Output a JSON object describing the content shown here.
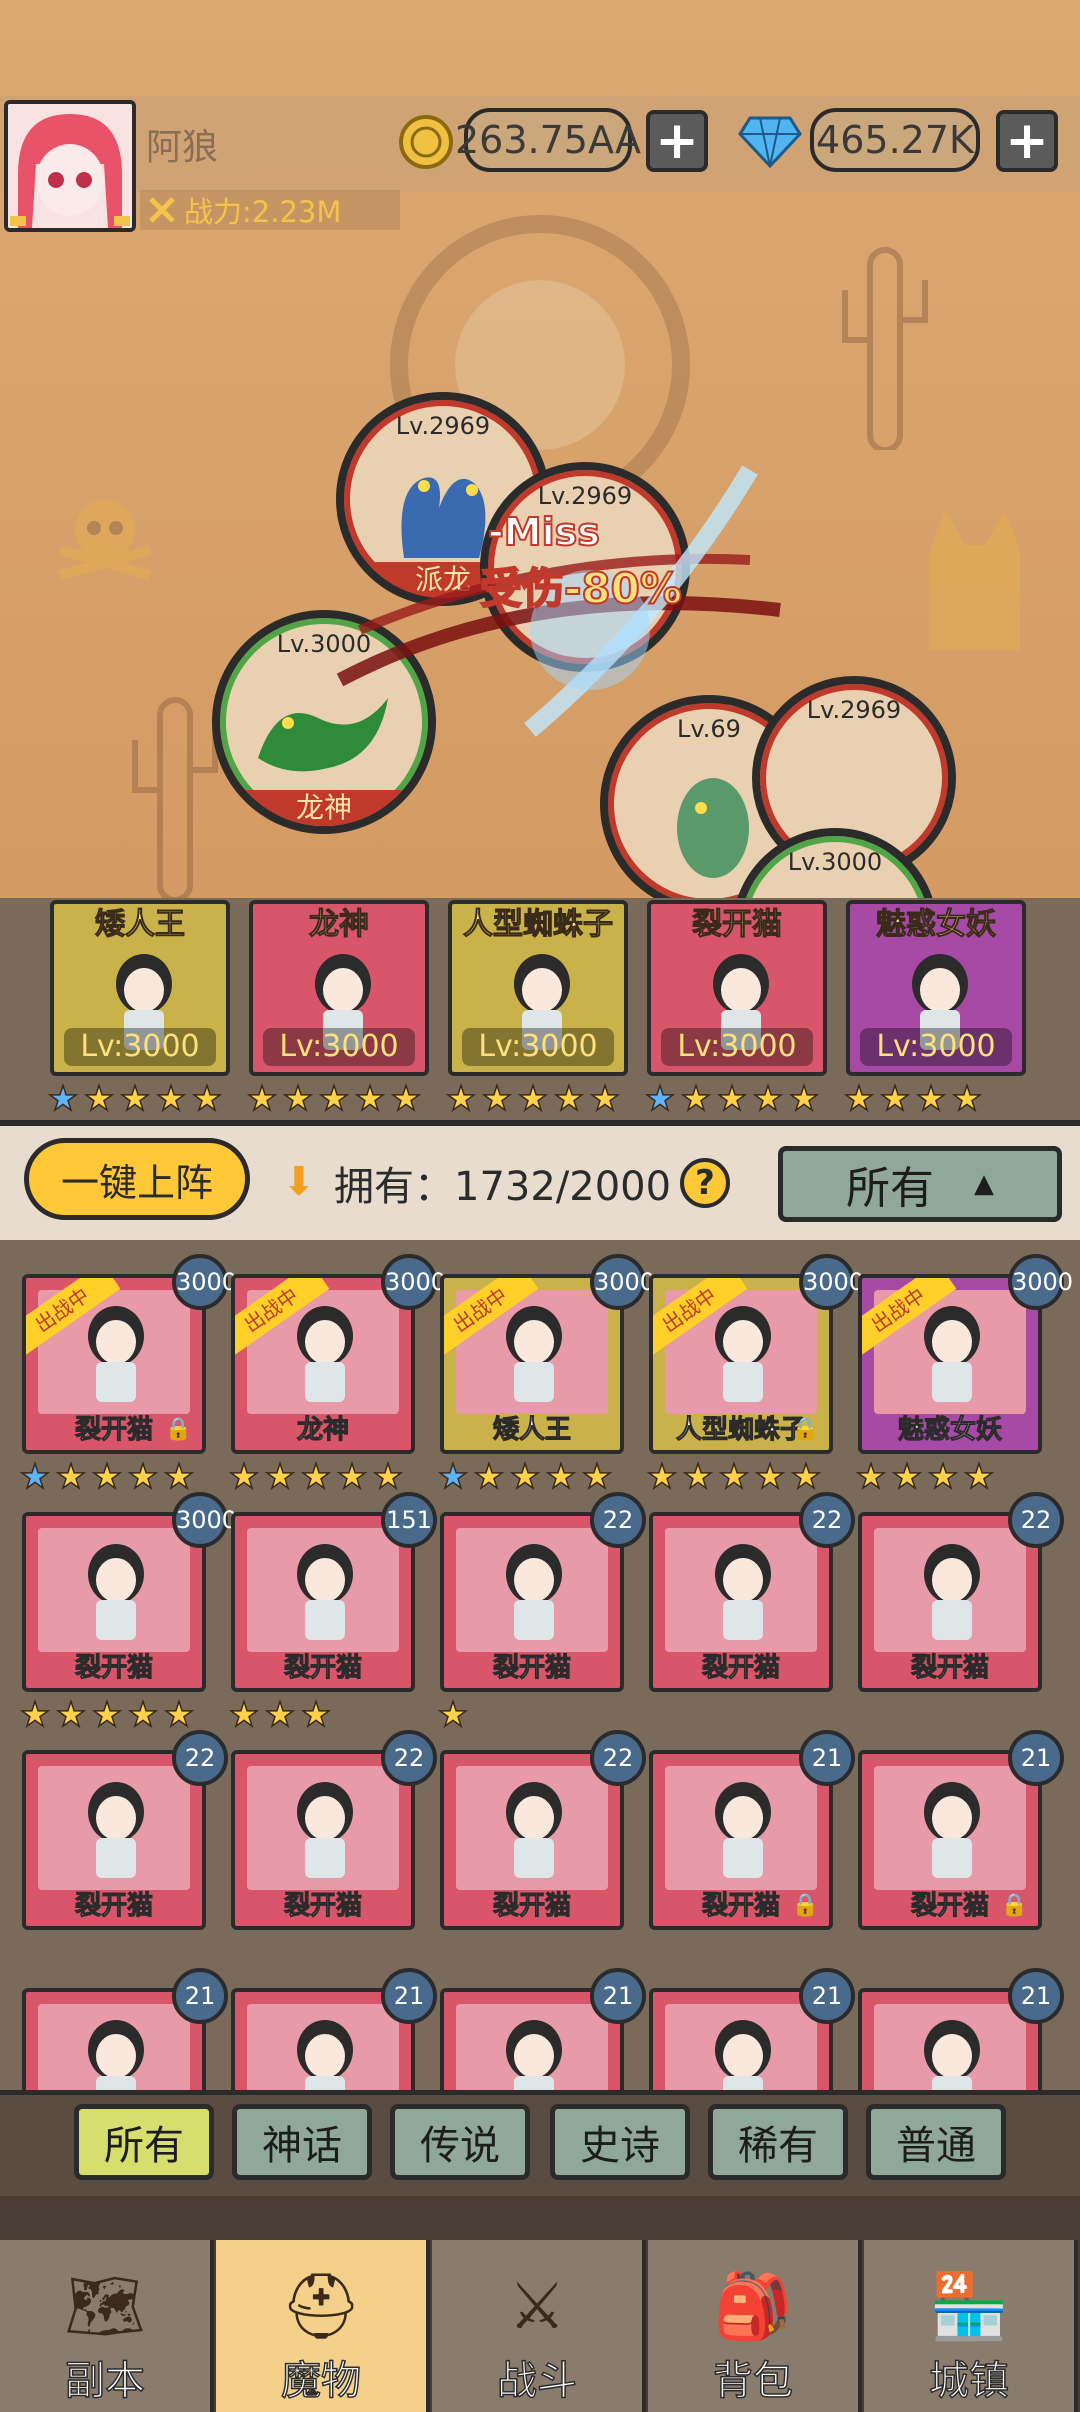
{
  "player": {
    "name": "阿狼",
    "power_label": "战力:2.23M",
    "gold": "263.75AA",
    "gems": "465.27K"
  },
  "battle": {
    "units": [
      {
        "side": "enemy",
        "level": "Lv.2969",
        "name": "派龙"
      },
      {
        "side": "enemy",
        "level": "Lv.2969",
        "name": ""
      },
      {
        "side": "ally",
        "level": "Lv.3000",
        "name": "龙神"
      },
      {
        "side": "enemy",
        "level": "Lv.69",
        "name": ""
      },
      {
        "side": "enemy",
        "level": "Lv.2969",
        "name": ""
      },
      {
        "side": "ally",
        "level": "Lv.3000",
        "name": ""
      }
    ],
    "miss_text": "-Miss",
    "damage_text": "受伤-80%"
  },
  "lineup": [
    {
      "name": "矮人王",
      "level": "Lv:3000",
      "color": "#c9b24a"
    },
    {
      "name": "龙神",
      "level": "Lv:3000",
      "color": "#d9566a"
    },
    {
      "name": "人型蜘蛛子",
      "level": "Lv:3000",
      "color": "#c9b24a"
    },
    {
      "name": "裂开猫",
      "level": "Lv:3000",
      "color": "#d9566a"
    },
    {
      "name": "魅惑女妖",
      "level": "Lv:3000",
      "color": "#a64aa6"
    }
  ],
  "controls": {
    "deploy_button": "一键上阵",
    "owned_label": "拥有：1732/2000",
    "filter_value": "所有",
    "help": "?"
  },
  "monsters": [
    {
      "name": "裂开猫",
      "level": "3000",
      "deployed": true,
      "locked": true,
      "color": "#d9566a"
    },
    {
      "name": "龙神",
      "level": "3000",
      "deployed": true,
      "locked": false,
      "color": "#d9566a"
    },
    {
      "name": "矮人王",
      "level": "3000",
      "deployed": true,
      "locked": false,
      "color": "#c9b24a"
    },
    {
      "name": "人型蜘蛛子",
      "level": "3000",
      "deployed": true,
      "locked": true,
      "color": "#c9b24a"
    },
    {
      "name": "魅惑女妖",
      "level": "3000",
      "deployed": true,
      "locked": false,
      "color": "#a64aa6"
    },
    {
      "name": "裂开猫",
      "level": "3000",
      "deployed": false,
      "locked": false,
      "color": "#d9566a"
    },
    {
      "name": "裂开猫",
      "level": "151",
      "deployed": false,
      "locked": false,
      "color": "#d9566a"
    },
    {
      "name": "裂开猫",
      "level": "22",
      "deployed": false,
      "locked": false,
      "color": "#d9566a"
    },
    {
      "name": "裂开猫",
      "level": "22",
      "deployed": false,
      "locked": false,
      "color": "#d9566a"
    },
    {
      "name": "裂开猫",
      "level": "22",
      "deployed": false,
      "locked": false,
      "color": "#d9566a"
    },
    {
      "name": "裂开猫",
      "level": "22",
      "deployed": false,
      "locked": false,
      "color": "#d9566a"
    },
    {
      "name": "裂开猫",
      "level": "22",
      "deployed": false,
      "locked": false,
      "color": "#d9566a"
    },
    {
      "name": "裂开猫",
      "level": "22",
      "deployed": false,
      "locked": false,
      "color": "#d9566a"
    },
    {
      "name": "裂开猫",
      "level": "21",
      "deployed": false,
      "locked": true,
      "color": "#d9566a"
    },
    {
      "name": "裂开猫",
      "level": "21",
      "deployed": false,
      "locked": true,
      "color": "#d9566a"
    },
    {
      "name": "",
      "level": "21",
      "deployed": false,
      "locked": false,
      "color": "#d9566a"
    },
    {
      "name": "",
      "level": "21",
      "deployed": false,
      "locked": false,
      "color": "#d9566a"
    },
    {
      "name": "",
      "level": "21",
      "deployed": false,
      "locked": false,
      "color": "#d9566a"
    },
    {
      "name": "",
      "level": "21",
      "deployed": false,
      "locked": false,
      "color": "#d9566a"
    },
    {
      "name": "",
      "level": "21",
      "deployed": false,
      "locked": false,
      "color": "#d9566a"
    }
  ],
  "deployed_ribbon": "出战中",
  "rarity_tabs": [
    "所有",
    "神话",
    "传说",
    "史诗",
    "稀有",
    "普通"
  ],
  "nav": [
    {
      "label": "副本",
      "icon": "map-icon"
    },
    {
      "label": "魔物",
      "icon": "monster-helmet-icon"
    },
    {
      "label": "战斗",
      "icon": "crossed-swords-icon"
    },
    {
      "label": "背包",
      "icon": "backpack-icon"
    },
    {
      "label": "城镇",
      "icon": "town-shop-icon"
    }
  ],
  "nav_active": "魔物"
}
